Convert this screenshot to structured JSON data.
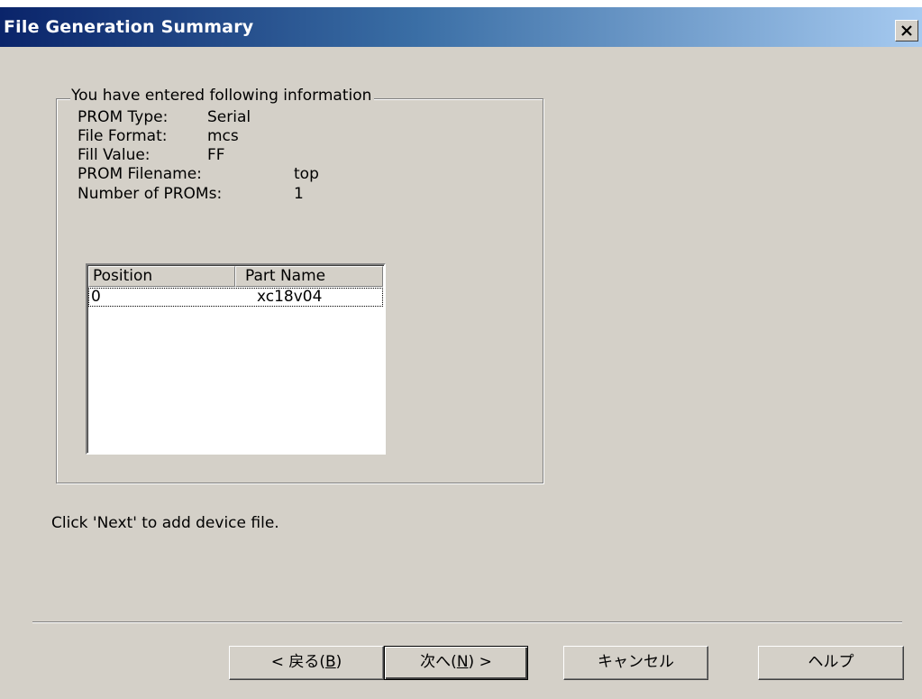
{
  "window": {
    "title": "File Generation Summary"
  },
  "summary": {
    "group_title": "You have entered following information",
    "rows": [
      {
        "label": "PROM Type:",
        "value": "Serial"
      },
      {
        "label": "File Format:",
        "value": "mcs"
      },
      {
        "label": "Fill Value:",
        "value": "FF"
      },
      {
        "label": "PROM Filename:",
        "value": "top"
      },
      {
        "label": "Number of PROMs:",
        "value": "1"
      }
    ]
  },
  "table": {
    "columns": [
      "Position",
      "Part Name"
    ],
    "rows": [
      {
        "position": "0",
        "part_name": "xc18v04"
      }
    ]
  },
  "hint": "Click 'Next' to add device file.",
  "buttons": {
    "back": {
      "before": "< 戻る(",
      "key": "B",
      "after": ")"
    },
    "next": {
      "before": "次へ(",
      "key": "N",
      "after": ") >"
    },
    "cancel": "キャンセル",
    "help": "ヘルプ"
  },
  "icons": {
    "close": "close-icon"
  }
}
